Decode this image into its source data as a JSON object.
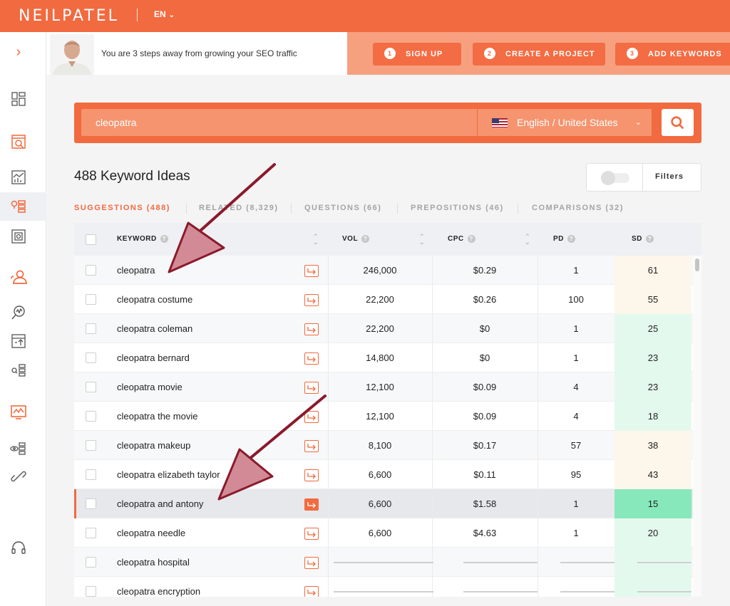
{
  "app": {
    "logo": "NEILPATEL",
    "language": "EN"
  },
  "banner": {
    "message": "You are 3 steps away from growing your SEO traffic",
    "steps": [
      {
        "num": "1",
        "label": "SIGN UP"
      },
      {
        "num": "2",
        "label": "CREATE A PROJECT"
      },
      {
        "num": "3",
        "label": "ADD KEYWORDS"
      }
    ]
  },
  "search": {
    "value": "cleopatra",
    "locale": "English / United States"
  },
  "results": {
    "title": "488 Keyword Ideas",
    "filters_label": "Filters"
  },
  "tabs": [
    {
      "label": "SUGGESTIONS (488)"
    },
    {
      "label": "RELATED (8,329)"
    },
    {
      "label": "QUESTIONS (66)"
    },
    {
      "label": "PREPOSITIONS (46)"
    },
    {
      "label": "COMPARISONS (32)"
    }
  ],
  "table": {
    "columns": {
      "keyword": "KEYWORD",
      "vol": "VOL",
      "cpc": "CPC",
      "pd": "PD",
      "sd": "SD"
    },
    "rows": [
      {
        "keyword": "cleopatra",
        "vol": "246,000",
        "cpc": "$0.29",
        "pd": "1",
        "sd": "61"
      },
      {
        "keyword": "cleopatra costume",
        "vol": "22,200",
        "cpc": "$0.26",
        "pd": "100",
        "sd": "55"
      },
      {
        "keyword": "cleopatra coleman",
        "vol": "22,200",
        "cpc": "$0",
        "pd": "1",
        "sd": "25"
      },
      {
        "keyword": "cleopatra bernard",
        "vol": "14,800",
        "cpc": "$0",
        "pd": "1",
        "sd": "23"
      },
      {
        "keyword": "cleopatra movie",
        "vol": "12,100",
        "cpc": "$0.09",
        "pd": "4",
        "sd": "23"
      },
      {
        "keyword": "cleopatra the movie",
        "vol": "12,100",
        "cpc": "$0.09",
        "pd": "4",
        "sd": "18"
      },
      {
        "keyword": "cleopatra makeup",
        "vol": "8,100",
        "cpc": "$0.17",
        "pd": "57",
        "sd": "38"
      },
      {
        "keyword": "cleopatra elizabeth taylor",
        "vol": "6,600",
        "cpc": "$0.11",
        "pd": "95",
        "sd": "43"
      },
      {
        "keyword": "cleopatra and antony",
        "vol": "6,600",
        "cpc": "$1.58",
        "pd": "1",
        "sd": "15"
      },
      {
        "keyword": "cleopatra needle",
        "vol": "6,600",
        "cpc": "$4.63",
        "pd": "1",
        "sd": "20"
      },
      {
        "keyword": "cleopatra hospital",
        "vol": null,
        "cpc": null,
        "pd": null,
        "sd": null
      },
      {
        "keyword": "cleopatra encryption",
        "vol": null,
        "cpc": null,
        "pd": null,
        "sd": null
      }
    ]
  },
  "colors": {
    "brand": "#f26a3f",
    "sd_easy": "#e4f9ee",
    "sd_medium": "#fdf6ea",
    "sd_highlight": "#86e8bb",
    "annotation_arrow": "#8b1a2b"
  }
}
